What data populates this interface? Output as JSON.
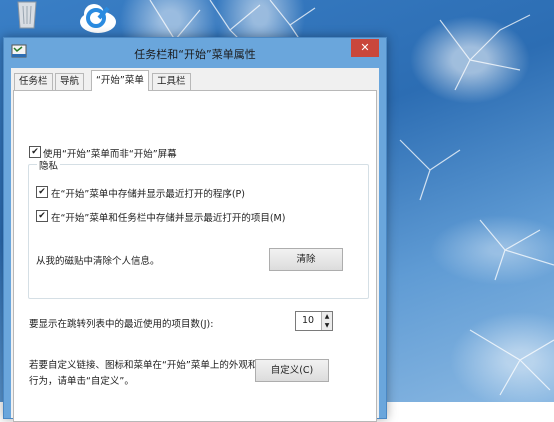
{
  "window": {
    "title": "任务栏和“开始”菜单属性",
    "close_glyph": "✕"
  },
  "tabs": [
    {
      "label": "任务栏"
    },
    {
      "label": "导航"
    },
    {
      "label": "“开始”菜单",
      "active": true
    },
    {
      "label": "工具栏"
    }
  ],
  "start_menu": {
    "use_start_menu_label": "使用“开始”菜单而非“开始”屏幕",
    "use_start_menu_checked": true
  },
  "privacy": {
    "group_title": "隐私",
    "store_programs_label": "在“开始”菜单中存储并显示最近打开的程序(P)",
    "store_programs_checked": true,
    "store_items_label": "在“开始”菜单和任务栏中存储并显示最近打开的项目(M)",
    "store_items_checked": true,
    "clear_info_label": "从我的磁贴中清除个人信息。",
    "clear_button": "清除"
  },
  "jump_list": {
    "label": "要显示在跳转列表中的最近使用的项目数(J):",
    "value": "10"
  },
  "customize": {
    "description_line1": "若要自定义链接、图标和菜单在“开始”菜单上的外观和",
    "description_line2": "行为，请单击“自定义”。",
    "button": "自定义(C)"
  },
  "desktop_icons": [
    "recycle-bin-icon",
    "cloud-app-icon"
  ],
  "colors": {
    "close_button": "#c9473b",
    "titlebar": "#6aa6dc"
  }
}
